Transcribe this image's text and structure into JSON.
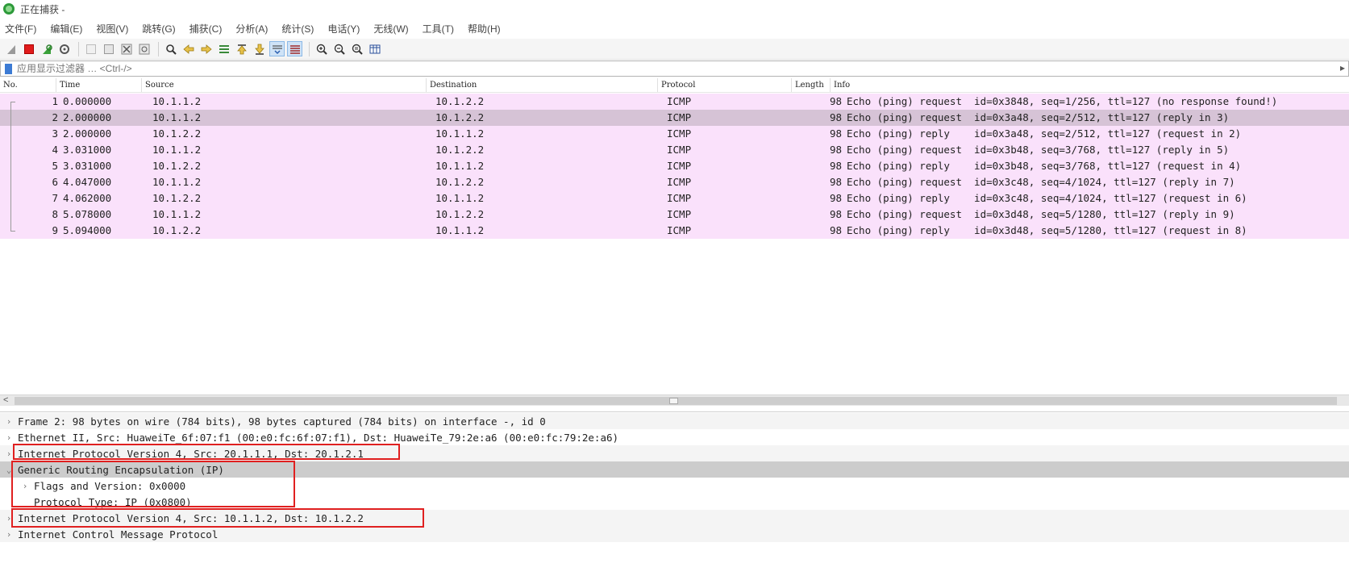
{
  "window": {
    "title": "正在捕获 -"
  },
  "menu": [
    "文件(F)",
    "编辑(E)",
    "视图(V)",
    "跳转(G)",
    "捕获(C)",
    "分析(A)",
    "统计(S)",
    "电话(Y)",
    "无线(W)",
    "工具(T)",
    "帮助(H)"
  ],
  "toolbar": {
    "icons": [
      "shark-fin-start-icon",
      "stop-capture-icon",
      "restart-capture-icon",
      "capture-options-icon",
      "open-file-icon",
      "save-file-icon",
      "close-file-icon",
      "reload-file-icon",
      "find-packet-icon",
      "go-back-icon",
      "go-forward-icon",
      "go-to-packet-icon",
      "go-first-icon",
      "go-last-icon",
      "autoscroll-icon",
      "colorize-icon",
      "zoom-in-icon",
      "zoom-out-icon",
      "zoom-normal-icon",
      "resize-columns-icon"
    ]
  },
  "filter": {
    "label": "应用显示过滤器 … <Ctrl-/>"
  },
  "columns": {
    "no": "No.",
    "time": "Time",
    "source": "Source",
    "destination": "Destination",
    "protocol": "Protocol",
    "length": "Length",
    "info": "Info"
  },
  "packets": [
    {
      "no": "1",
      "time": "0.000000",
      "source": "10.1.1.2",
      "destination": "10.1.2.2",
      "protocol": "ICMP",
      "length": "98",
      "info": "Echo (ping) request  id=0x3848, seq=1/256, ttl=127 (no response found!)"
    },
    {
      "no": "2",
      "time": "2.000000",
      "source": "10.1.1.2",
      "destination": "10.1.2.2",
      "protocol": "ICMP",
      "length": "98",
      "info": "Echo (ping) request  id=0x3a48, seq=2/512, ttl=127 (reply in 3)"
    },
    {
      "no": "3",
      "time": "2.000000",
      "source": "10.1.2.2",
      "destination": "10.1.1.2",
      "protocol": "ICMP",
      "length": "98",
      "info": "Echo (ping) reply    id=0x3a48, seq=2/512, ttl=127 (request in 2)"
    },
    {
      "no": "4",
      "time": "3.031000",
      "source": "10.1.1.2",
      "destination": "10.1.2.2",
      "protocol": "ICMP",
      "length": "98",
      "info": "Echo (ping) request  id=0x3b48, seq=3/768, ttl=127 (reply in 5)"
    },
    {
      "no": "5",
      "time": "3.031000",
      "source": "10.1.2.2",
      "destination": "10.1.1.2",
      "protocol": "ICMP",
      "length": "98",
      "info": "Echo (ping) reply    id=0x3b48, seq=3/768, ttl=127 (request in 4)"
    },
    {
      "no": "6",
      "time": "4.047000",
      "source": "10.1.1.2",
      "destination": "10.1.2.2",
      "protocol": "ICMP",
      "length": "98",
      "info": "Echo (ping) request  id=0x3c48, seq=4/1024, ttl=127 (reply in 7)"
    },
    {
      "no": "7",
      "time": "4.062000",
      "source": "10.1.2.2",
      "destination": "10.1.1.2",
      "protocol": "ICMP",
      "length": "98",
      "info": "Echo (ping) reply    id=0x3c48, seq=4/1024, ttl=127 (request in 6)"
    },
    {
      "no": "8",
      "time": "5.078000",
      "source": "10.1.1.2",
      "destination": "10.1.2.2",
      "protocol": "ICMP",
      "length": "98",
      "info": "Echo (ping) request  id=0x3d48, seq=5/1280, ttl=127 (reply in 9)"
    },
    {
      "no": "9",
      "time": "5.094000",
      "source": "10.1.2.2",
      "destination": "10.1.1.2",
      "protocol": "ICMP",
      "length": "98",
      "info": "Echo (ping) reply    id=0x3d48, seq=5/1280, ttl=127 (request in 8)"
    }
  ],
  "details": [
    {
      "text": "Frame 2: 98 bytes on wire (784 bits), 98 bytes captured (784 bits) on interface -, id 0",
      "chevron": "›"
    },
    {
      "text": "Ethernet II, Src: HuaweiTe_6f:07:f1 (00:e0:fc:6f:07:f1), Dst: HuaweiTe_79:2e:a6 (00:e0:fc:79:2e:a6)",
      "chevron": "›"
    },
    {
      "text": "Internet Protocol Version 4, Src: 20.1.1.1, Dst: 20.1.2.1",
      "chevron": "›"
    },
    {
      "text": "Generic Routing Encapsulation (IP)",
      "chevron": "⌄"
    },
    {
      "text": "Flags and Version: 0x0000",
      "chevron": "›"
    },
    {
      "text": "Protocol Type: IP (0x0800)",
      "chevron": "›"
    },
    {
      "text": "Internet Protocol Version 4, Src: 10.1.1.2, Dst: 10.1.2.2",
      "chevron": "›"
    },
    {
      "text": "Internet Control Message Protocol",
      "chevron": "›"
    }
  ],
  "colors": {
    "icmp_row": "#fae1fb",
    "selected_row": "#d6c3d6",
    "highlight_box": "#e02020"
  }
}
